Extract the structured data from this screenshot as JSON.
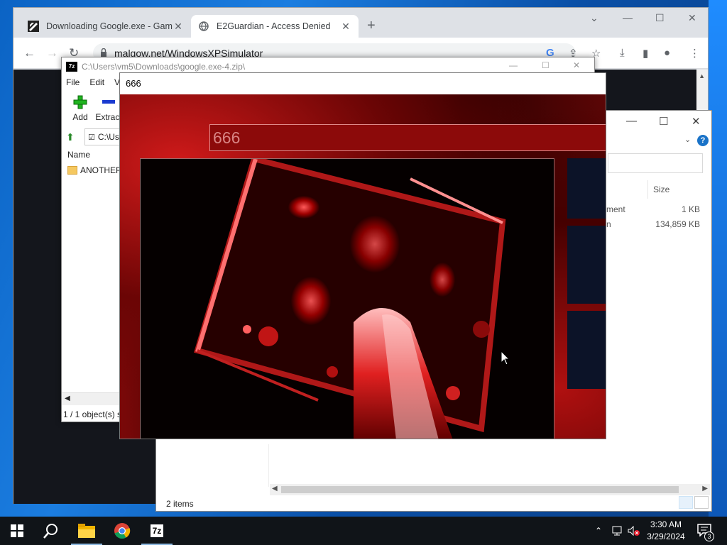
{
  "chrome": {
    "tabs": [
      {
        "title": "Downloading Google.exe - Game",
        "active": false
      },
      {
        "title": "E2Guardian - Access Denied",
        "active": true
      }
    ],
    "url": "malgow.net/WindowsXPSimulator"
  },
  "sevenzip": {
    "title": "C:\\Users\\vm5\\Downloads\\google.exe-4.zip\\",
    "menu": [
      "File",
      "Edit",
      "Vi"
    ],
    "tools": [
      {
        "label": "Add"
      },
      {
        "label": "Extract"
      }
    ],
    "address": "C:\\Us",
    "column_name": "Name",
    "file": "ANOTHER Y",
    "status": "1 / 1 object(s) s"
  },
  "explorer": {
    "column_size": "Size",
    "rows": [
      {
        "type": "ment",
        "size": "1 KB"
      },
      {
        "type": "n",
        "size": "134,859 KB"
      }
    ],
    "status": "2 items"
  },
  "popup": {
    "title": "666",
    "bar_text": "666"
  },
  "taskbar": {
    "time": "3:30 AM",
    "date": "3/29/2024",
    "notifications": "3",
    "apps": [
      "start-icon",
      "search-icon",
      "file-explorer-icon",
      "chrome-icon",
      "7zip-icon"
    ]
  },
  "colors": {
    "popup_red": "#8c0a0a",
    "taskbar": "#101418",
    "desktop": "#0b63c4"
  }
}
